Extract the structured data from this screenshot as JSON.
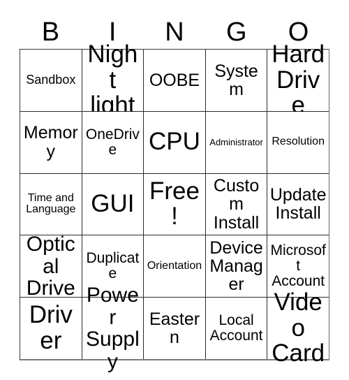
{
  "card": {
    "title_letters": [
      "B",
      "I",
      "N",
      "G",
      "O"
    ],
    "colors": {
      "background": "#ffffff",
      "text": "#000000",
      "grid_line": "#2b2b2b"
    },
    "rows": [
      [
        {
          "label": "Sandbox",
          "size": "sm"
        },
        {
          "label": "Night light",
          "size": "xxl"
        },
        {
          "label": "OOBE",
          "size": "lg"
        },
        {
          "label": "System",
          "size": "lg"
        },
        {
          "label": "Hard Drive",
          "size": "xxl"
        }
      ],
      [
        {
          "label": "Memory",
          "size": "lg"
        },
        {
          "label": "OneDrive",
          "size": "md"
        },
        {
          "label": "CPU",
          "size": "xxl"
        },
        {
          "label": "Administrator",
          "size": "xxs"
        },
        {
          "label": "Resolution",
          "size": "xs"
        }
      ],
      [
        {
          "label": "Time and Language",
          "size": "xs"
        },
        {
          "label": "GUI",
          "size": "xxl"
        },
        {
          "label": "Free!",
          "size": "xxl"
        },
        {
          "label": "Custom Install",
          "size": "lg"
        },
        {
          "label": "Update Install",
          "size": "lg"
        }
      ],
      [
        {
          "label": "Optical Drive",
          "size": "xl"
        },
        {
          "label": "Duplicate",
          "size": "md"
        },
        {
          "label": "Orientation",
          "size": "xs"
        },
        {
          "label": "Device Manager",
          "size": "lg"
        },
        {
          "label": "Microsoft Account",
          "size": "md"
        }
      ],
      [
        {
          "label": "Driver",
          "size": "xxl"
        },
        {
          "label": "Power Supply",
          "size": "xl"
        },
        {
          "label": "Eastern",
          "size": "lg"
        },
        {
          "label": "Local Account",
          "size": "md"
        },
        {
          "label": "Video Card",
          "size": "xxl"
        }
      ]
    ]
  }
}
